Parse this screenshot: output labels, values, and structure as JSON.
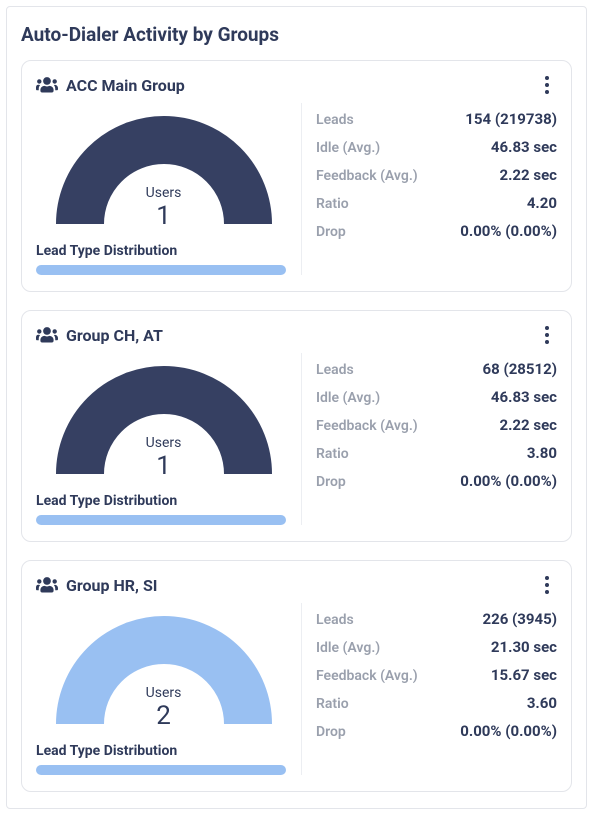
{
  "title": "Auto-Dialer Activity by Groups",
  "labels": {
    "users": "Users",
    "distribution": "Lead Type Distribution",
    "leads": "Leads",
    "idle": "Idle (Avg.)",
    "feedback": "Feedback (Avg.)",
    "ratio": "Ratio",
    "drop": "Drop"
  },
  "colors": {
    "dark_gauge": "#364062",
    "light_gauge": "#99c0f2",
    "bar": "#99c0f2"
  },
  "groups": [
    {
      "name": "ACC Main Group",
      "users": "1",
      "gauge_color": "#364062",
      "leads": "154 (219738)",
      "idle": "46.83 sec",
      "feedback": "2.22 sec",
      "ratio": "4.20",
      "drop": "0.00% (0.00%)"
    },
    {
      "name": "Group CH, AT",
      "users": "1",
      "gauge_color": "#364062",
      "leads": "68 (28512)",
      "idle": "46.83 sec",
      "feedback": "2.22 sec",
      "ratio": "3.80",
      "drop": "0.00% (0.00%)"
    },
    {
      "name": "Group HR, SI",
      "users": "2",
      "gauge_color": "#99c0f2",
      "leads": "226 (3945)",
      "idle": "21.30 sec",
      "feedback": "15.67 sec",
      "ratio": "3.60",
      "drop": "0.00% (0.00%)"
    }
  ]
}
